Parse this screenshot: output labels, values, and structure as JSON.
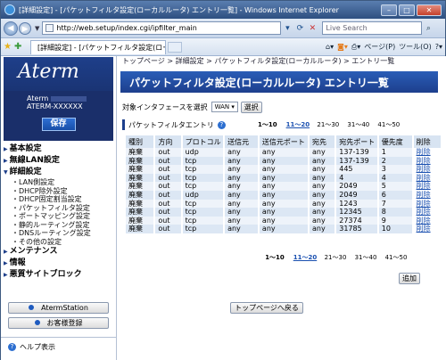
{
  "window": {
    "title": "[詳細設定] - [パケットフィルタ設定(ローカルルータ) エントリ一覧] - Windows Internet Explorer",
    "url": "http://web.setup/index.cgi/ipfilter_main",
    "search_placeholder": "Live Search",
    "tab_title": "[詳細設定] - [パケットフィルタ設定(ローカル...",
    "page_menu": "ページ(P)",
    "tools_menu": "ツール(O)"
  },
  "sidebar": {
    "logo": "Aterm",
    "model_line1": "Aterm",
    "model_line2": "ATERM-XXXXXX",
    "save_label": "保存",
    "menu": [
      {
        "label": "基本設定"
      },
      {
        "label": "無線LAN設定"
      },
      {
        "label": "詳細設定"
      }
    ],
    "submenu": [
      "・LAN側設定",
      "・DHCP除外設定",
      "・DHCP固定割当設定",
      "・パケットフィルタ設定",
      "・ポートマッピング設定",
      "・静的ルーティング設定",
      "・DNSルーティング設定",
      "・その他の設定"
    ],
    "menu2": [
      {
        "label": "メンテナンス"
      },
      {
        "label": "情報"
      },
      {
        "label": "悪質サイトブロック"
      }
    ],
    "aterm_station": "AtermStation",
    "register": "お客様登録",
    "help": "ヘルプ表示"
  },
  "main": {
    "breadcrumb": "トップページ > 詳細設定 > パケットフィルタ設定(ローカルルータ) > エントリ一覧",
    "title": "パケットフィルタ設定(ローカルルータ) エントリ一覧",
    "interface_label": "対象インタフェースを選択",
    "interface_value": "WAN",
    "select_button": "選択",
    "entry_heading": "パケットフィルタエントリ",
    "pages": [
      "1〜10",
      "11〜20",
      "21〜30",
      "31〜40",
      "41〜50"
    ],
    "columns": [
      "種別",
      "方向",
      "プロトコル",
      "送信元",
      "送信元ポート",
      "宛先",
      "宛先ポート",
      "優先度",
      "削除"
    ],
    "rows": [
      [
        "廃棄",
        "out",
        "udp",
        "any",
        "any",
        "any",
        "137-139",
        "1",
        "削除"
      ],
      [
        "廃棄",
        "out",
        "tcp",
        "any",
        "any",
        "any",
        "137-139",
        "2",
        "削除"
      ],
      [
        "廃棄",
        "out",
        "tcp",
        "any",
        "any",
        "any",
        "445",
        "3",
        "削除"
      ],
      [
        "廃棄",
        "out",
        "tcp",
        "any",
        "any",
        "any",
        "4",
        "4",
        "削除"
      ],
      [
        "廃棄",
        "out",
        "tcp",
        "any",
        "any",
        "any",
        "2049",
        "5",
        "削除"
      ],
      [
        "廃棄",
        "out",
        "udp",
        "any",
        "any",
        "any",
        "2049",
        "6",
        "削除"
      ],
      [
        "廃棄",
        "out",
        "tcp",
        "any",
        "any",
        "any",
        "1243",
        "7",
        "削除"
      ],
      [
        "廃棄",
        "out",
        "tcp",
        "any",
        "any",
        "any",
        "12345",
        "8",
        "削除"
      ],
      [
        "廃棄",
        "out",
        "tcp",
        "any",
        "any",
        "any",
        "27374",
        "9",
        "削除"
      ],
      [
        "廃棄",
        "out",
        "tcp",
        "any",
        "any",
        "any",
        "31785",
        "10",
        "削除"
      ]
    ],
    "add_button": "追加",
    "top_button": "トップページへ戻る"
  }
}
